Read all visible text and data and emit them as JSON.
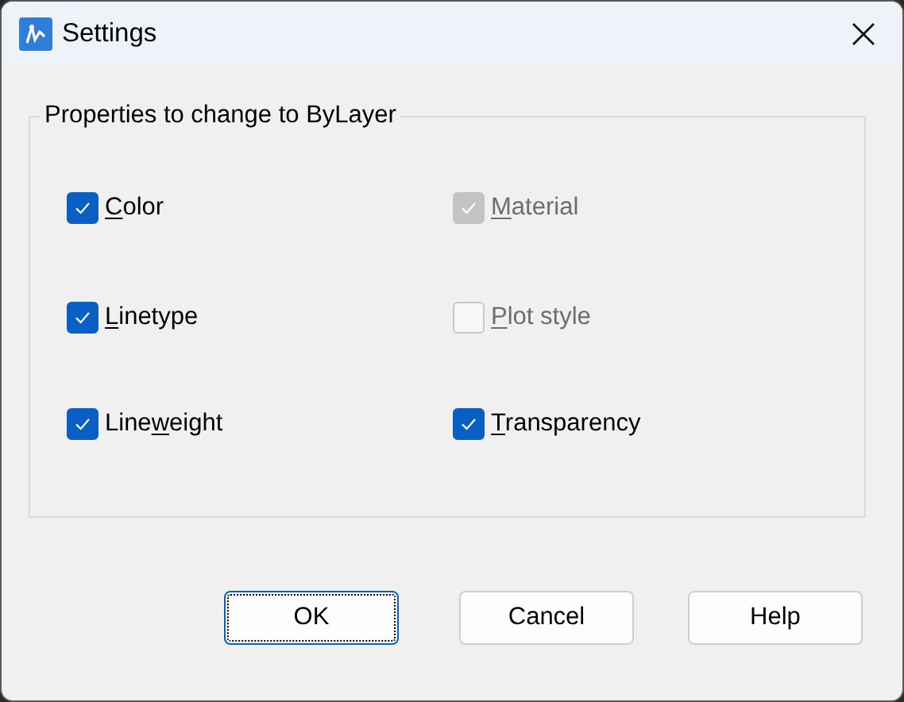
{
  "window": {
    "title": "Settings"
  },
  "group": {
    "title": "Properties to change to ByLayer",
    "options": [
      {
        "label": [
          {
            "text": "C",
            "underlined": true
          },
          {
            "text": "olor",
            "underlined": false
          }
        ],
        "checked": true,
        "disabled": false
      },
      {
        "label": [
          {
            "text": "M",
            "underlined": true
          },
          {
            "text": "aterial",
            "underlined": false
          }
        ],
        "checked": true,
        "disabled": true
      },
      {
        "label": [
          {
            "text": "L",
            "underlined": true
          },
          {
            "text": "inetype",
            "underlined": false
          }
        ],
        "checked": true,
        "disabled": false
      },
      {
        "label": [
          {
            "text": "P",
            "underlined": true
          },
          {
            "text": "lot style",
            "underlined": false
          }
        ],
        "checked": false,
        "disabled": true
      },
      {
        "label": [
          {
            "text": "Line",
            "underlined": false
          },
          {
            "text": "w",
            "underlined": true
          },
          {
            "text": "eight",
            "underlined": false
          }
        ],
        "checked": true,
        "disabled": false
      },
      {
        "label": [
          {
            "text": "T",
            "underlined": true
          },
          {
            "text": "ransparency",
            "underlined": false
          }
        ],
        "checked": true,
        "disabled": false
      }
    ]
  },
  "buttons": [
    {
      "label": "OK",
      "default": true
    },
    {
      "label": "Cancel",
      "default": false
    },
    {
      "label": "Help",
      "default": false
    }
  ]
}
